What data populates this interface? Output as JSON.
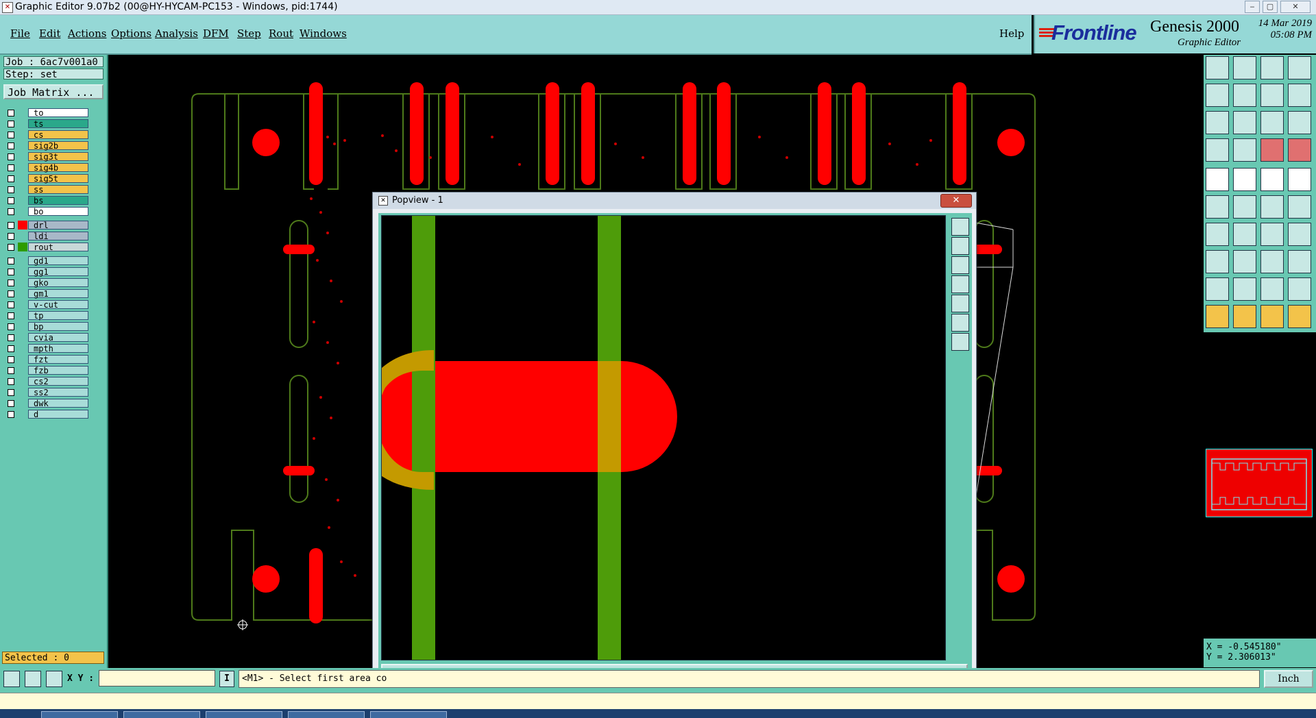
{
  "window": {
    "title": "Graphic Editor 9.07b2 (00@HY-HYCAM-PC153 - Windows, pid:1744)",
    "icon": "app-icon"
  },
  "menu": {
    "items": [
      "File",
      "Edit",
      "Actions",
      "Options",
      "Analysis",
      "DFM",
      "Step",
      "Rout",
      "Windows"
    ],
    "help": "Help"
  },
  "brand": {
    "logo": "Frontline",
    "product": "Genesis 2000",
    "subtitle": "Graphic Editor",
    "date": "14 Mar 2019",
    "time": "05:08 PM"
  },
  "job": {
    "job_label": "Job : 6ac7v001a0",
    "step_label": "Step: set",
    "matrix_button": "Job Matrix ..."
  },
  "layers": {
    "board": [
      {
        "name": "to",
        "bg": "#ffffff"
      },
      {
        "name": "ts",
        "bg": "#2aa88a"
      },
      {
        "name": "cs",
        "bg": "#f3c34a"
      },
      {
        "name": "sig2b",
        "bg": "#f3c34a"
      },
      {
        "name": "sig3t",
        "bg": "#f3c34a"
      },
      {
        "name": "sig4b",
        "bg": "#f3c34a"
      },
      {
        "name": "sig5t",
        "bg": "#f3c34a"
      },
      {
        "name": "ss",
        "bg": "#f3c34a"
      },
      {
        "name": "bs",
        "bg": "#2aa88a"
      },
      {
        "name": "bo",
        "bg": "#ffffff"
      }
    ],
    "drill": [
      {
        "name": "drl",
        "bg": "#a8b8c8",
        "swatch": "#ff0000"
      },
      {
        "name": "ldi",
        "bg": "#a8b8c8",
        "swatch": ""
      },
      {
        "name": "rout",
        "bg": "#c8d8d8",
        "swatch": "#2e9c00"
      }
    ],
    "misc": [
      {
        "name": "gd1"
      },
      {
        "name": "gg1"
      },
      {
        "name": "gko"
      },
      {
        "name": "gm1"
      },
      {
        "name": "v-cut"
      },
      {
        "name": "tp"
      },
      {
        "name": "bp"
      },
      {
        "name": "cvia"
      },
      {
        "name": "mpth"
      },
      {
        "name": "fzt"
      },
      {
        "name": "fzb"
      },
      {
        "name": "cs2"
      },
      {
        "name": "ss2"
      },
      {
        "name": "dwk"
      },
      {
        "name": "d"
      }
    ],
    "misc_bg": "#a8dcd8"
  },
  "selected": "Selected : 0",
  "popview": {
    "title": "Popview - 1",
    "close_label": "Close"
  },
  "coords": {
    "x": "X = -0.545180\"",
    "y": "Y = 2.306013\""
  },
  "bottom": {
    "xy_label": "X Y :",
    "xy_value": "",
    "info_button": "I",
    "prompt": "<M1> - Select first area co",
    "units": "Inch"
  },
  "colors": {
    "panel": "#68c8b2",
    "menu": "#95d8d6",
    "pad": "#ff0000",
    "rout": "#4e9c0a",
    "overlap": "#c49a00"
  }
}
